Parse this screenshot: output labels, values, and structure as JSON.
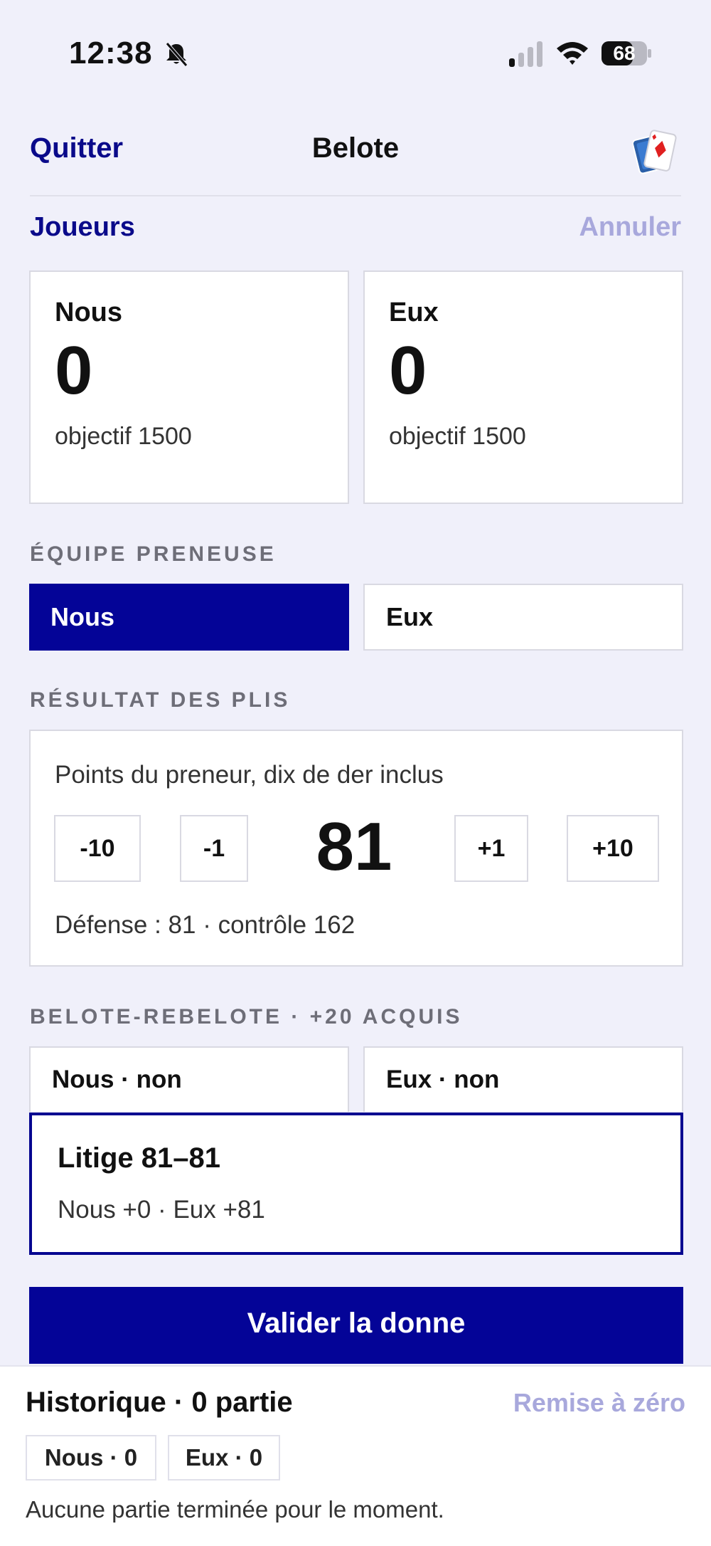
{
  "status_bar": {
    "time": "12:38",
    "battery": "68"
  },
  "nav": {
    "quit": "Quitter",
    "title": "Belote"
  },
  "players_row": {
    "players": "Joueurs",
    "cancel": "Annuler"
  },
  "scores": [
    {
      "name": "Nous",
      "value": "0",
      "goal": "objectif 1500"
    },
    {
      "name": "Eux",
      "value": "0",
      "goal": "objectif 1500"
    }
  ],
  "taker": {
    "label": "ÉQUIPE PRENEUSE",
    "options": [
      "Nous",
      "Eux"
    ],
    "selected": "Nous"
  },
  "tricks": {
    "label": "RÉSULTAT DES PLIS",
    "caption": "Points du preneur, dix de der inclus",
    "buttons": {
      "minus10": "-10",
      "minus1": "-1",
      "plus1": "+1",
      "plus10": "+10"
    },
    "value": "81",
    "defense": "Défense : 81 · contrôle 162"
  },
  "belote": {
    "label": "BELOTE-REBELOTE · +20 ACQUIS",
    "left": "Nous · non",
    "right": "Eux · non"
  },
  "litige": {
    "title": "Litige 81–81",
    "detail": "Nous +0 · Eux +81"
  },
  "validate_label": "Valider la donne",
  "history": {
    "title": "Historique · 0 partie",
    "reset": "Remise à zéro",
    "chips": [
      "Nous · 0",
      "Eux · 0"
    ],
    "empty": "Aucune partie terminée pour le moment."
  },
  "colors": {
    "accent": "#040497",
    "link": "#0a0a8a",
    "muted_link": "#a8a8dc",
    "background": "#f0f0fa"
  }
}
